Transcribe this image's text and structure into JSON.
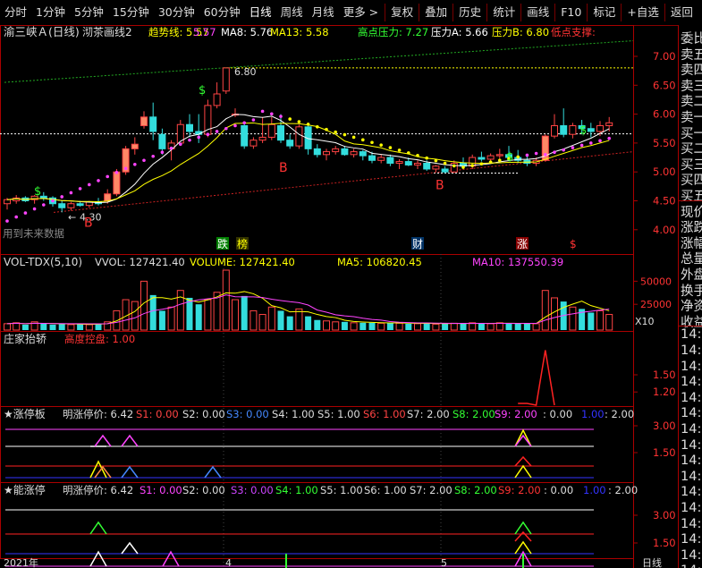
{
  "toolbar": {
    "periods": [
      "分时",
      "1分钟",
      "5分钟",
      "15分钟",
      "30分钟",
      "60分钟",
      "日线",
      "周线",
      "月线",
      "更多 >"
    ],
    "active_period": "日线",
    "actions": [
      "复权",
      "叠加",
      "历史",
      "统计",
      "画线",
      "F10",
      "标记",
      "+自选",
      "返回"
    ]
  },
  "main_panel": {
    "stock_name": "渝三峡Ａ(日线)",
    "indicator_name": "沏茶画线2",
    "legend": [
      {
        "label": "趋势线: 5.57",
        "color": "#ffff00"
      },
      {
        "label": "5.57",
        "color": "#ff44ff"
      },
      {
        "label": "MA8: 5.76",
        "color": "#ffffff"
      },
      {
        "label": "MA13: 5.58",
        "color": "#ffff00"
      },
      {
        "label": "高点压力: 7.27",
        "color": "#33ff33"
      },
      {
        "label": "压力A: 5.66",
        "color": "#ffffff"
      },
      {
        "label": "压力B: 6.80",
        "color": "#ffff00"
      },
      {
        "label": "低点支撑:",
        "color": "#ff3333"
      }
    ],
    "y_ticks": [
      "7.00",
      "6.50",
      "6.00",
      "5.50",
      "5.00",
      "4.50",
      "4.00"
    ],
    "high_label": "6.80",
    "low_label": "4.30",
    "b_labels": [
      "B",
      "B",
      "B"
    ],
    "future_note": "用到未来数据",
    "tags": [
      {
        "text": "跌",
        "color": "#ffffff",
        "bg": "#008000"
      },
      {
        "text": "榜",
        "color": "#ffff00",
        "bg": "#333300"
      },
      {
        "text": "财",
        "color": "#ffffff",
        "bg": "#003366"
      },
      {
        "text": "涨",
        "color": "#ffffff",
        "bg": "#880000"
      },
      {
        "text": "$",
        "color": "#ff3333",
        "bg": ""
      }
    ],
    "dollar_marks": [
      "$",
      "$",
      "$",
      "$"
    ]
  },
  "vol_panel": {
    "name": "VOL-TDX(5,10)",
    "legend": [
      {
        "label": "VVOL: 127421.40",
        "color": "#dddddd"
      },
      {
        "label": "VOLUME: 127421.40",
        "color": "#ffff00"
      },
      {
        "label": "MA5: 106820.45",
        "color": "#ffff00"
      },
      {
        "label": "MA10: 137550.39",
        "color": "#ff44ff"
      }
    ],
    "y_ticks": [
      "50000",
      "25000"
    ],
    "unit": "X10"
  },
  "zhuang_panel": {
    "name": "庄家抬轿",
    "legend": [
      {
        "label": "高度控盘: 1.00",
        "color": "#ff3333"
      }
    ],
    "y_ticks": [
      "1.50",
      "1.20"
    ]
  },
  "zt1_panel": {
    "name": "★涨停板",
    "legend": [
      {
        "label": "明涨停价: 6.42",
        "color": "#dddddd"
      },
      {
        "label": "S1: 0.00",
        "color": "#ff4444"
      },
      {
        "label": "S2: 0.00",
        "color": "#dddddd"
      },
      {
        "label": "S3: 0.00",
        "color": "#4488ff"
      },
      {
        "label": "S4: 1.00",
        "color": "#dddddd"
      },
      {
        "label": "S5: 1.00",
        "color": "#dddddd"
      },
      {
        "label": "S6: 1.00",
        "color": "#ff4444"
      },
      {
        "label": "S7: 2.00",
        "color": "#dddddd"
      },
      {
        "label": "S8: 2.00",
        "color": "#33ff33"
      },
      {
        "label": "S9: 2.00",
        "color": "#ff44ff"
      },
      {
        "label": ": 0.00",
        "color": "#dddddd"
      },
      {
        "label": "1.00",
        "color": "#3333ff"
      },
      {
        "label": ": 2.00",
        "color": "#dddddd"
      }
    ],
    "y_ticks": [
      "3.00",
      "1.50"
    ]
  },
  "zt2_panel": {
    "name": "★能涨停",
    "legend": [
      {
        "label": "明涨停价: 6.42",
        "color": "#dddddd"
      },
      {
        "label": "S1: 0.00",
        "color": "#ff44ff"
      },
      {
        "label": "S2: 0.00",
        "color": "#dddddd"
      },
      {
        "label": "S3: 0.00",
        "color": "#cc44ff"
      },
      {
        "label": "S4: 1.00",
        "color": "#33ff33"
      },
      {
        "label": "S5: 1.00",
        "color": "#dddddd"
      },
      {
        "label": "S6: 1.00",
        "color": "#dddddd"
      },
      {
        "label": "S7: 2.00",
        "color": "#dddddd"
      },
      {
        "label": "S8: 2.00",
        "color": "#33ff33"
      },
      {
        "label": "S9: 2.00",
        "color": "#ff3333"
      },
      {
        "label": ": 0.00",
        "color": "#dddddd"
      },
      {
        "label": "1.00",
        "color": "#3333ff"
      },
      {
        "label": ": 2.00",
        "color": "#dddddd"
      }
    ],
    "y_ticks": [
      "3.00",
      "1.50"
    ]
  },
  "x_axis": {
    "labels": [
      "2021年",
      "4",
      "5"
    ],
    "period": "日线"
  },
  "side_panel": {
    "items": [
      "委比",
      "卖五",
      "卖四",
      "卖三",
      "卖二",
      "卖一",
      "买一",
      "买二",
      "买三",
      "买四",
      "买五",
      "现价",
      "涨跌",
      "涨幅",
      "总量",
      "外盘",
      "换手",
      "净资",
      "收益",
      "14:5",
      "14:5",
      "14:5",
      "14:5",
      "14:5",
      "14:5",
      "14:5",
      "14:5",
      "14:5",
      "14:5",
      "14:5",
      "14:5",
      "14:5",
      "14:5",
      "14:5",
      "14:5"
    ]
  }
}
